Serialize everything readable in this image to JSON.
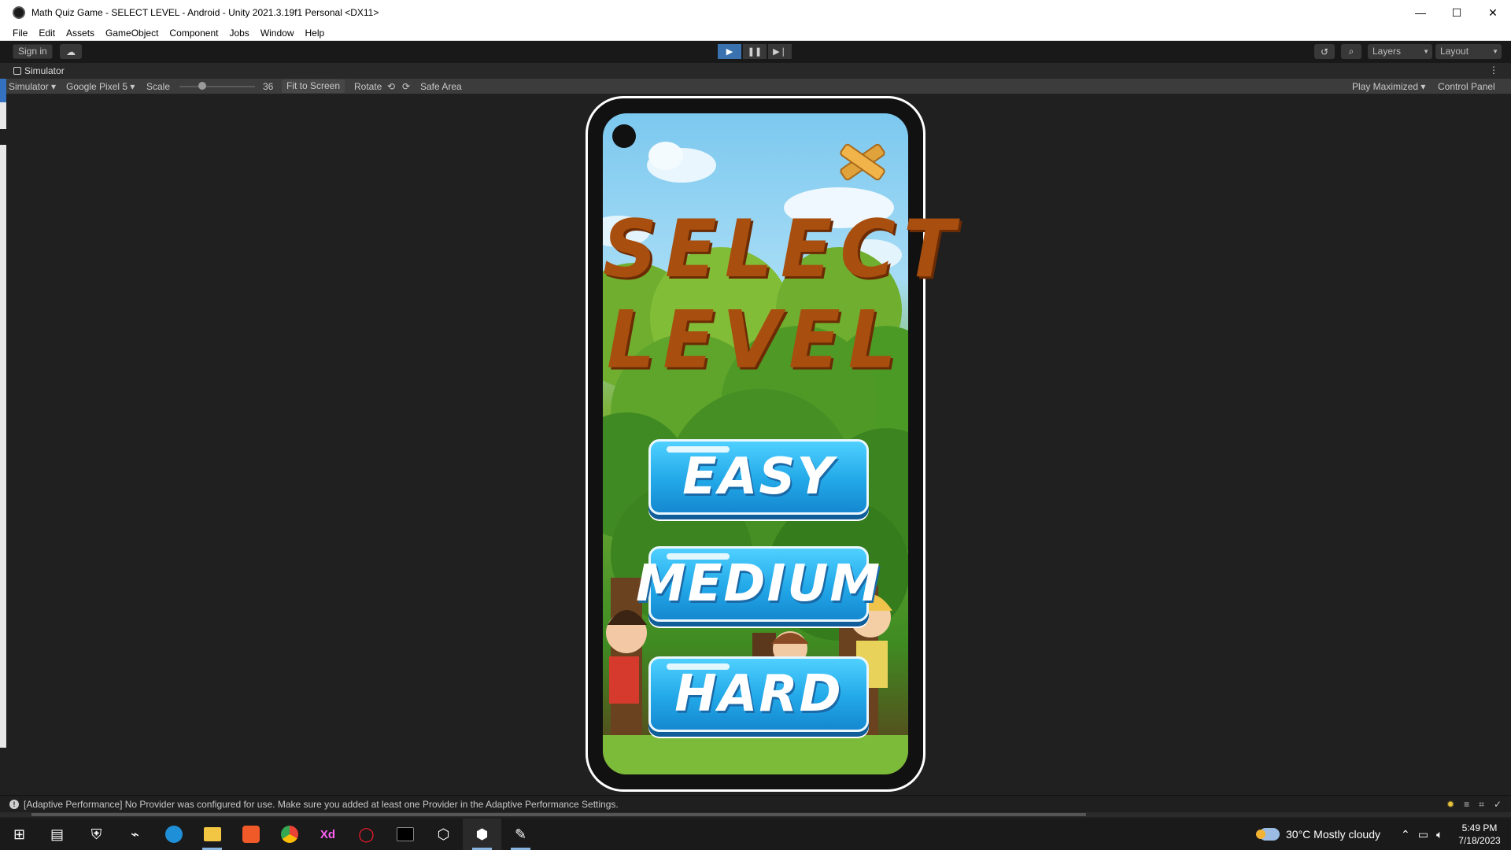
{
  "window": {
    "title": "Math Quiz Game - SELECT LEVEL - Android - Unity 2021.3.19f1 Personal <DX11>",
    "minimize_glyph": "—",
    "maximize_glyph": "☐",
    "close_glyph": "✕"
  },
  "menu": [
    "File",
    "Edit",
    "Assets",
    "GameObject",
    "Component",
    "Jobs",
    "Window",
    "Help"
  ],
  "toolbar": {
    "sign_in": "Sign in",
    "layers": "Layers",
    "layout": "Layout"
  },
  "simulator": {
    "tab_label": "Simulator",
    "mode": "Simulator",
    "device": "Google Pixel 5",
    "scale_label": "Scale",
    "scale_value": "36",
    "fit_to_screen": "Fit to Screen",
    "rotate": "Rotate",
    "safe_area": "Safe Area",
    "play_maximized": "Play Maximized",
    "control_panel": "Control Panel"
  },
  "game": {
    "title_line1": "SELECT",
    "title_line2": "LEVEL",
    "buttons": [
      "EASY",
      "MEDIUM",
      "HARD"
    ]
  },
  "status": {
    "message": "[Adaptive Performance] No Provider was configured for use. Make sure you added at least one Provider in the Adaptive Performance Settings."
  },
  "taskbar": {
    "weather": "30°C  Mostly cloudy",
    "time": "5:49 PM",
    "date": "7/18/2023",
    "xd_label": "Xd"
  },
  "colors": {
    "play_active": "#3a72b0",
    "title_brown": "#a84e0e",
    "button_blue": "#22a8e8"
  }
}
